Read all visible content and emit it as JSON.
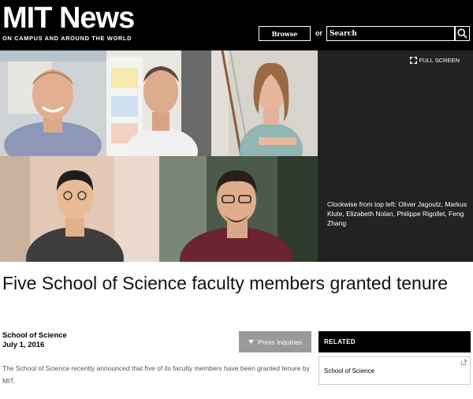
{
  "header": {
    "logo": "MIT News",
    "tagline": "ON CAMPUS AND AROUND THE WORLD",
    "browse_label": "Browse",
    "or_text": "or",
    "search_placeholder": "Search"
  },
  "gallery": {
    "fullscreen_label": "FULL SCREEN",
    "caption": "Clockwise from top left: Oliver Jagoutz, Markus Klute, Elizabeth Nolan, Philippe Rigollet, Feng Zhang"
  },
  "article": {
    "title": "Five School of Science faculty members granted tenure",
    "department": "School of Science",
    "date": "July 1, 2016",
    "press_label": "Press Inquiries",
    "lede": "The School of Science recently announced that five of its faculty members have been granted tenure by MIT."
  },
  "related": {
    "heading": "RELATED",
    "items": [
      "School of Science"
    ]
  },
  "colors": {
    "header_bg": "#000000",
    "caption_bg": "#222222",
    "press_button_bg": "#999999"
  }
}
